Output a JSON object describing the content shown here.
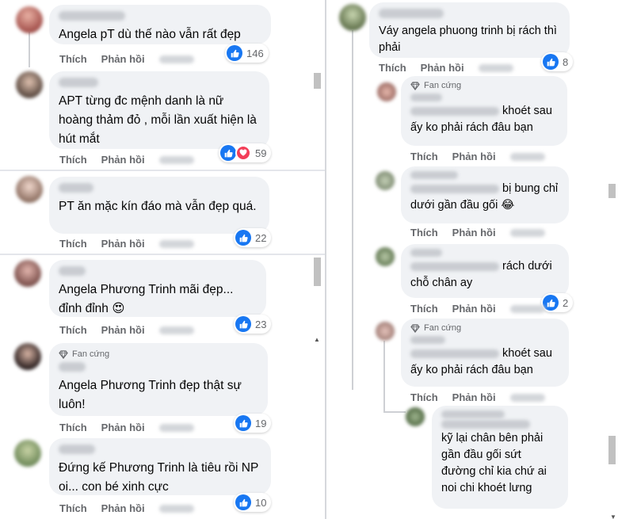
{
  "actions": {
    "like": "Thích",
    "reply": "Phản hồi"
  },
  "badge": {
    "fan": "Fan cứng"
  },
  "left": [
    {
      "text": "Angela pT dù thế nào vẫn rất đẹp",
      "count": "146"
    },
    {
      "text": "APT từng đc mệnh danh là nữ hoàng thảm đỏ , mỗi lần xuất hiện là hút mắt",
      "count": "59"
    },
    {
      "text": "PT ăn mặc kín đáo mà vẫn đẹp quá.",
      "count": "22"
    },
    {
      "text": "Angela Phương Trinh mãi đẹp... đỉnh đỉnh 😍",
      "count": "23"
    },
    {
      "text": "Angela Phương Trinh đẹp thật sự luôn!",
      "count": "19"
    },
    {
      "text": "Đứng kế Phương Trinh là tiêu rồi NP oi... con bé xinh cực",
      "count": "10"
    }
  ],
  "right": [
    {
      "text": "Váy angela phuong trinh bị rách thì phải",
      "count": "8"
    },
    {
      "text": "khoét sau ấy ko phải rách đâu bạn",
      "count": ""
    },
    {
      "text": "bị bung chỉ dưới gần đầu gối 😂",
      "count": ""
    },
    {
      "text": "rách dưới chỗ chân ay",
      "count": "2"
    },
    {
      "text": "khoét sau ấy ko phải rách đâu bạn",
      "count": ""
    },
    {
      "text": "kỹ lại chân bên phải gần đầu gối sứt đường chỉ kia chứ ai noi chi khoét lưng",
      "count": ""
    }
  ],
  "colors": {
    "like": "#1877f2",
    "love": "#f33e58",
    "bubble": "#f0f2f5",
    "meta": "#65676b"
  },
  "icons": {
    "like": "thumbs-up-icon",
    "love": "heart-icon",
    "badge": "diamond-icon"
  }
}
